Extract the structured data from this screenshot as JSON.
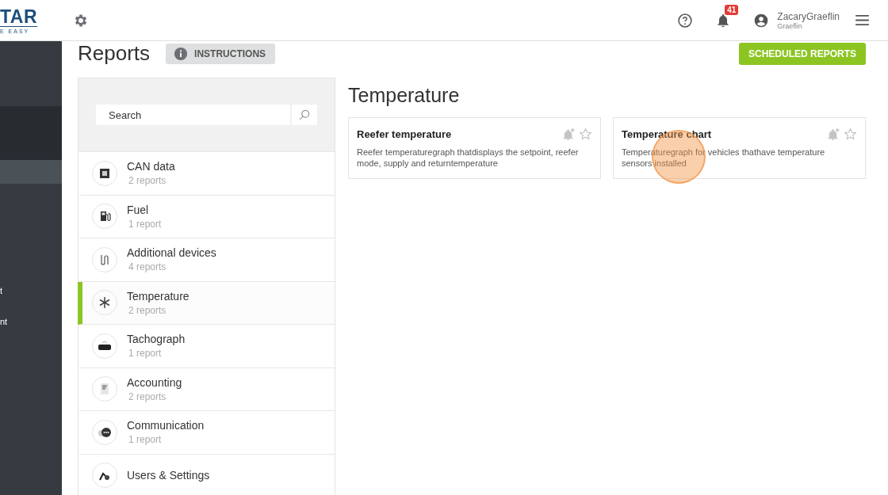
{
  "logo": {
    "name": "TAR",
    "tagline": "E EASY"
  },
  "topbar": {
    "notifications": "41",
    "user_name": "ZacaryGraeflin",
    "user_sub": "Graeflin"
  },
  "side_nav": {
    "items": [
      {
        "selected": true
      },
      {
        "label": "t",
        "selected": false
      },
      {
        "label": "nt",
        "selected": false
      }
    ]
  },
  "page": {
    "title": "Reports",
    "instructions_button": "INSTRUCTIONS",
    "scheduled_button": "SCHEDULED REPORTS"
  },
  "search": {
    "placeholder": "Search"
  },
  "categories": [
    {
      "kind": "chip",
      "name": "CAN data",
      "count": "2 reports",
      "selected": false
    },
    {
      "kind": "fuel",
      "name": "Fuel",
      "count": "1 report",
      "selected": false
    },
    {
      "kind": "cable",
      "name": "Additional devices",
      "count": "4 reports",
      "selected": false
    },
    {
      "kind": "snow",
      "name": "Temperature",
      "count": "2 reports",
      "selected": true
    },
    {
      "kind": "tacho",
      "name": "Tachograph",
      "count": "1 report",
      "selected": false
    },
    {
      "kind": "doc",
      "name": "Accounting",
      "count": "2 reports",
      "selected": false
    },
    {
      "kind": "chat",
      "name": "Communication",
      "count": "1 report",
      "selected": false
    },
    {
      "kind": "users",
      "name": "Users & Settings",
      "selected": false
    }
  ],
  "section": {
    "title": "Temperature",
    "reports": [
      {
        "title": "Reefer temperature",
        "description": "Reefer temperaturegraph thatdisplays the setpoint, reefer mode, supply and returntemperature",
        "favorite": false
      },
      {
        "title": "Temperature chart",
        "description": "Temperaturegraph for vehicles thathave temperature sensors installed",
        "favorite": false
      }
    ]
  }
}
